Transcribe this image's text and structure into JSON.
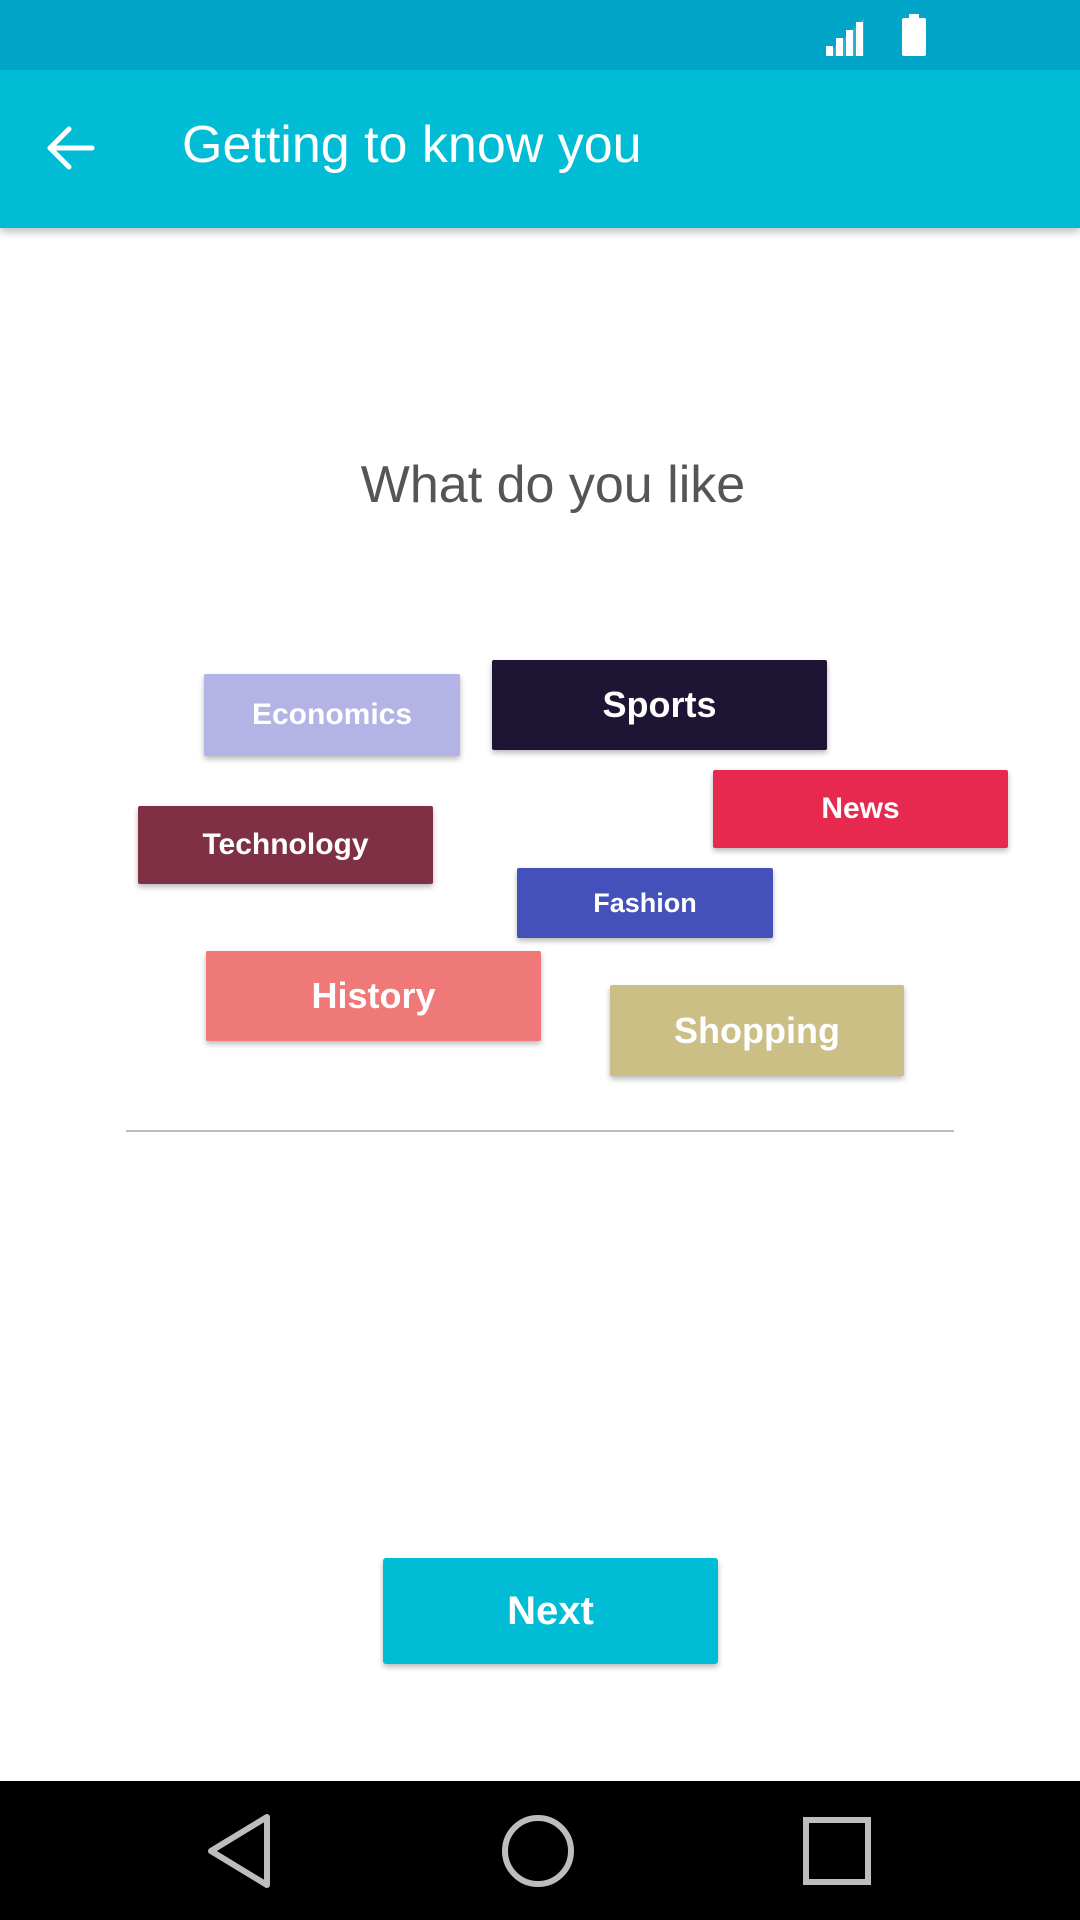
{
  "status_bar": {
    "signal_icon": "signal-icon",
    "battery_icon": "battery-icon",
    "color": "#00A5C8"
  },
  "app_bar": {
    "back_icon": "arrow-back-icon",
    "title": "Getting to know you",
    "color": "#00BCD5"
  },
  "main": {
    "question": "What do you like",
    "tags": [
      {
        "label": "Economics",
        "color": "#B3B3E6"
      },
      {
        "label": "Sports",
        "color": "#1E1535"
      },
      {
        "label": "News",
        "color": "#E8294F"
      },
      {
        "label": "Technology",
        "color": "#7F3045"
      },
      {
        "label": "Fashion",
        "color": "#4551BA"
      },
      {
        "label": "History",
        "color": "#EF7879"
      },
      {
        "label": "Shopping",
        "color": "#CCBF86"
      }
    ],
    "next_label": "Next",
    "next_color": "#00BCD5"
  },
  "nav_bar": {
    "back_icon": "triangle-back-icon",
    "home_icon": "circle-home-icon",
    "recents_icon": "square-recents-icon"
  }
}
